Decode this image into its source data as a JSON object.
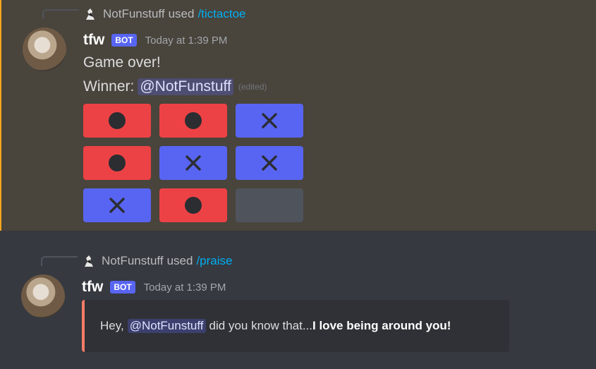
{
  "colors": {
    "background": "#36393f",
    "highlight_background": "#49443c",
    "highlight_border": "#faa61a",
    "bot_tag": "#5865f2",
    "command": "#00aff4",
    "red_button": "#ed4245",
    "blue_button": "#5865f2",
    "gray_button": "#4f545c",
    "embed_border": "#f47b67"
  },
  "messages": [
    {
      "reply": {
        "user": "NotFunstuff",
        "used": "used",
        "command": "/tictactoe"
      },
      "author": {
        "name": "tfw",
        "tag": "BOT",
        "timestamp": "Today at 1:39 PM"
      },
      "lines": {
        "line1": "Game over!",
        "winner_label": "Winner:",
        "mention": "@NotFunstuff",
        "edited": "(edited)"
      },
      "board": [
        {
          "mark": "circle",
          "color": "red"
        },
        {
          "mark": "circle",
          "color": "red"
        },
        {
          "mark": "x",
          "color": "blue"
        },
        {
          "mark": "circle",
          "color": "red"
        },
        {
          "mark": "x",
          "color": "blue"
        },
        {
          "mark": "x",
          "color": "blue"
        },
        {
          "mark": "x",
          "color": "blue"
        },
        {
          "mark": "circle",
          "color": "red"
        },
        {
          "mark": "empty",
          "color": "gray"
        }
      ]
    },
    {
      "reply": {
        "user": "NotFunstuff",
        "used": "used",
        "command": "/praise"
      },
      "author": {
        "name": "tfw",
        "tag": "BOT",
        "timestamp": "Today at 1:39 PM"
      },
      "embed": {
        "prefix": "Hey,",
        "mention": "@NotFunstuff",
        "middle": "did you know that...",
        "bold": "I love being around you!"
      }
    }
  ]
}
